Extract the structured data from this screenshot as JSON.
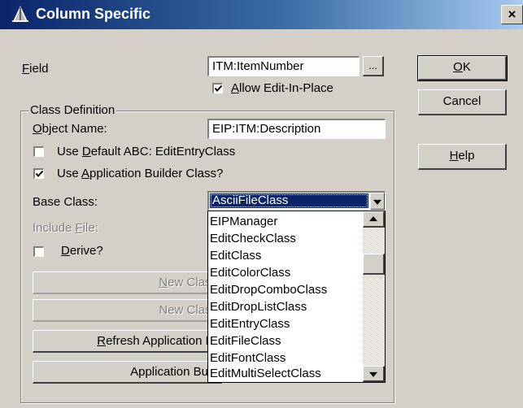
{
  "window": {
    "title": "Column Specific",
    "close_glyph": "×",
    "title_icon": "app-tent-icon",
    "accent": "#0a246a"
  },
  "field": {
    "label_prefix": "",
    "label_mnemonic": "F",
    "label_rest": "ield",
    "value": "ITM:ItemNumber",
    "browse_label": "..."
  },
  "allow_edit_in_place": {
    "checked": true,
    "label_mnemonic": "A",
    "label_rest": "llow Edit-In-Place"
  },
  "class_definition": {
    "group_title": "Class Definition",
    "object_name": {
      "label_mnemonic": "O",
      "label_rest": "bject Name:",
      "value": "EIP:ITM:Description"
    },
    "use_default": {
      "checked": false,
      "label_pre": "Use ",
      "label_mnemonic": "D",
      "label_rest": "efault ABC: EditEntryClass"
    },
    "use_app_builder": {
      "checked": true,
      "label_pre": "Use ",
      "label_mnemonic": "A",
      "label_rest": "pplication Builder Class?"
    },
    "base_class": {
      "label": "Base Class:",
      "selected": "AsciiFileClass",
      "options": [
        "EIPManager",
        "EditCheckClass",
        "EditClass",
        "EditColorClass",
        "EditDropComboClass",
        "EditDropListClass",
        "EditEntryClass",
        "EditFileClass",
        "EditFontClass",
        "EditMultiSelectClass"
      ]
    },
    "include_file": {
      "label_pre": "Include ",
      "label_mnemonic": "F",
      "label_rest": "ile:"
    },
    "derive": {
      "checked": false,
      "label_mnemonic": "D",
      "label_rest": "erive?"
    },
    "new_class_btn_1": {
      "mnemonic": "N",
      "rest": "ew Class"
    },
    "new_class_btn_2": {
      "label": "New Class"
    },
    "refresh_btn": {
      "mnemonic": "R",
      "rest": "efresh Application Bu"
    },
    "app_builder_btn": {
      "label": "Application Build"
    }
  },
  "buttons": {
    "ok": {
      "mnemonic": "O",
      "rest": "K"
    },
    "cancel": {
      "label": "Cancel"
    },
    "help": {
      "mnemonic": "H",
      "rest": "elp"
    }
  }
}
